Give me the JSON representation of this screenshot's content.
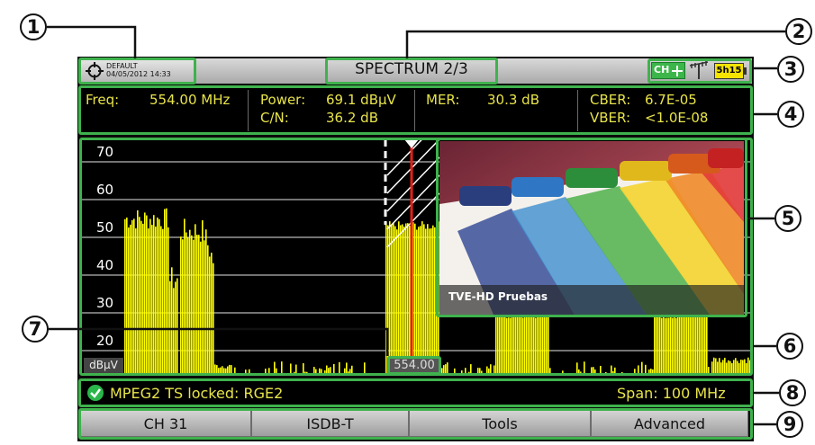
{
  "callouts": [
    "1",
    "2",
    "3",
    "4",
    "5",
    "6",
    "7",
    "8",
    "9"
  ],
  "header": {
    "preset": "DEFAULT",
    "datetime": "04/05/2012 14:33",
    "title": "SPECTRUM 2/3",
    "ch_badge": "CH",
    "battery": "5h15"
  },
  "measurements": {
    "freq_label": "Freq:",
    "freq_value": "554.00 MHz",
    "power_label": "Power:",
    "power_value": "69.1 dBµV",
    "cn_label": "C/N:",
    "cn_value": "36.2 dB",
    "mer_label": "MER:",
    "mer_value": "30.3 dB",
    "cber_label": "CBER:",
    "cber_value": "6.7E-05",
    "vber_label": "VBER:",
    "vber_value": "<1.0E-08"
  },
  "spectrum": {
    "y_ticks": [
      "70",
      "60",
      "50",
      "40",
      "30",
      "20"
    ],
    "unit": "dBµV",
    "marker_freq": "554.00",
    "bar_color": "#ffff00",
    "marker_color": "#e0221b"
  },
  "video": {
    "service_name": "TVE-HD Pruebas"
  },
  "status": {
    "lock_text": "MPEG2 TS locked: RGE2",
    "span_text": "Span: 100 MHz"
  },
  "softkeys": [
    "CH 31",
    "ISDB-T",
    "Tools",
    "Advanced"
  ],
  "colors": {
    "measure_text": "#e8e44a",
    "highlight": "#3fb24d"
  }
}
